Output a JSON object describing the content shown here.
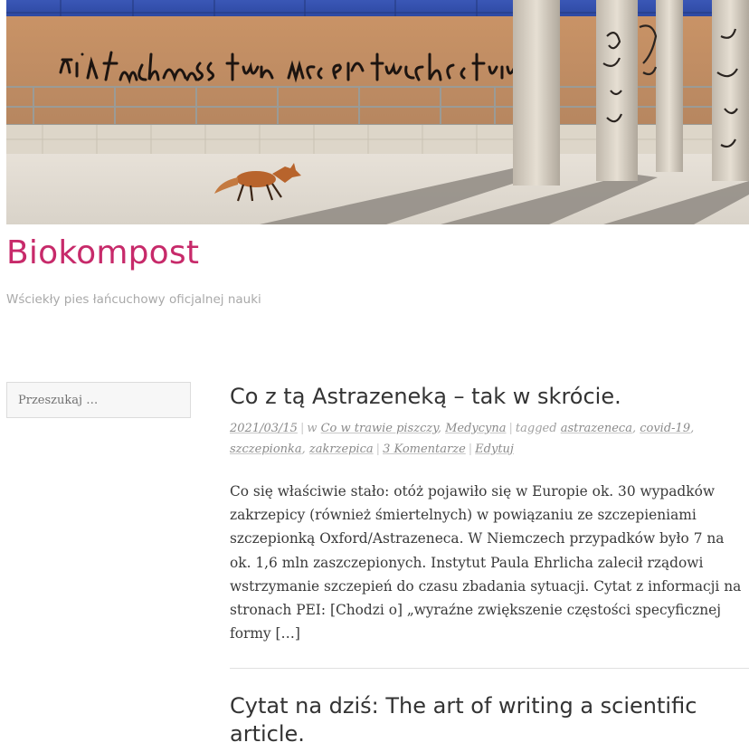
{
  "site": {
    "title": "Biokompost",
    "tagline": "Wściekły pies łańcuchowy oficjalnej nauki"
  },
  "header_image": {
    "graffiti_text": "Ein Fuchs muss tun was ein Fuchs tun muss"
  },
  "search": {
    "placeholder": "Przeszukaj …"
  },
  "posts": [
    {
      "title": "Co z tą Astrazeneką – tak w skrócie.",
      "date": "2021/03/15",
      "in_label": "w",
      "categories": [
        "Co w trawie piszczy",
        "Medycyna"
      ],
      "tagged_label": "tagged",
      "tags": [
        "astrazeneca",
        "covid-19",
        "szczepionka",
        "zakrzepica"
      ],
      "comments": "3 Komentarze",
      "edit": "Edytuj",
      "excerpt": "Co się właściwie stało: otóż pojawiło się w Europie ok. 30 wypadków zakrzepicy (również śmiertelnych) w powiązaniu ze szczepieniami szczepionką Oxford/Astrazeneca. W Niemczech przypadków było 7 na ok. 1,6 mln zaszczepionych. Instytut Paula Ehrlicha zalecił rządowi wstrzymanie szczepień do czasu zbadania sytuacji. Cytat z informacji na stronach PEI: [Chodzi o] „wyraźne zwiększenie częstości specyficznej formy",
      "more": "[…]"
    },
    {
      "title": "Cytat na dziś: The art of writing a scientific article."
    }
  ],
  "colors": {
    "site_title": "#c72a6a",
    "tagline": "#a9a9a9",
    "meta": "#a0a0a0",
    "body_text": "#3a3a3a"
  }
}
